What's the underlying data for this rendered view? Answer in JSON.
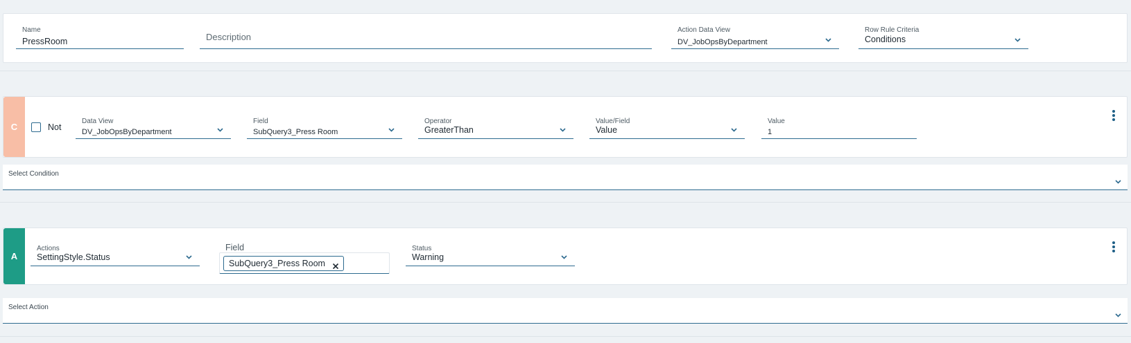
{
  "rule": {
    "name": {
      "label": "Name",
      "value": "PressRoom"
    },
    "description": {
      "placeholder": "Description"
    },
    "action_data_view": {
      "label": "Action Data View",
      "value": "DV_JobOpsByDepartment"
    },
    "row_rule_criteria": {
      "label": "Row Rule Criteria",
      "value": "Conditions"
    }
  },
  "condition": {
    "tag": "C",
    "tag_color": "#f8bea6",
    "not_label": "Not",
    "data_view": {
      "label": "Data View",
      "value": "DV_JobOpsByDepartment"
    },
    "field": {
      "label": "Field",
      "value": "SubQuery3_Press Room"
    },
    "operator": {
      "label": "Operator",
      "value": "GreaterThan"
    },
    "value_field": {
      "label": "Value/Field",
      "value": "Value"
    },
    "value": {
      "label": "Value",
      "value": "1"
    }
  },
  "select_condition": {
    "label": "Select Condition"
  },
  "action": {
    "tag": "A",
    "tag_color": "#1e9c86",
    "actions": {
      "label": "Actions",
      "value": "SettingStyle.Status"
    },
    "field": {
      "label": "Field",
      "chip": "SubQuery3_Press Room"
    },
    "status": {
      "label": "Status",
      "value": "Warning"
    }
  },
  "select_action": {
    "label": "Select Action"
  },
  "colors": {
    "accent": "#2c6a8f",
    "kebab": "#1e5f86"
  }
}
